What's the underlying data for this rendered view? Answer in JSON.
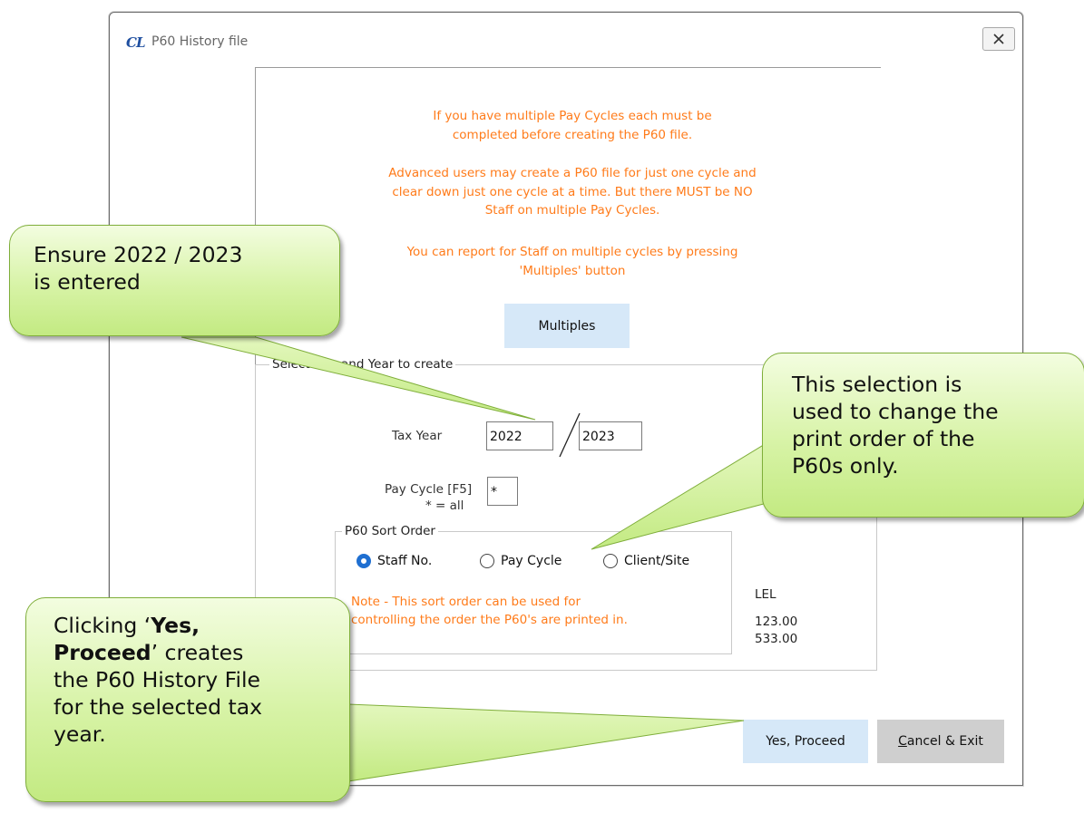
{
  "window": {
    "logo_text": "CL",
    "title": "P60 History file"
  },
  "info": {
    "para1_line1": "If you have multiple Pay Cycles each must be",
    "para1_line2": "completed before creating the P60 file.",
    "para2_line1": "Advanced users may create a P60 file for just one cycle and",
    "para2_line2": "clear down just one cycle at a time. But there MUST be NO",
    "para2_line3": "Staff on multiple Pay Cycles.",
    "para3_line1": "You can report for Staff on multiple cycles by pressing",
    "para3_line2": "'Multiples' button"
  },
  "buttons": {
    "multiples": "Multiples",
    "yes_proceed": "Yes, Proceed",
    "cancel_exit_underlined": "C",
    "cancel_exit_rest": "ancel & Exit"
  },
  "group": {
    "legend_visible": "Select",
    "legend_visible_tail": "and Year to create",
    "tax_year_label": "Tax Year",
    "tax_year_from": "2022",
    "tax_year_to": "2023",
    "pay_cycle_label": "Pay Cycle [F5]",
    "pay_cycle_hint": "* = all",
    "pay_cycle_value": "*"
  },
  "sort": {
    "legend": "P60 Sort Order",
    "options": [
      "Staff No.",
      "Pay Cycle",
      "Client/Site"
    ],
    "selected": "Staff No.",
    "note_line1": "Note - This sort order can be used for",
    "note_line2": "controlling the order the P60's are printed in."
  },
  "lel": {
    "label": "LEL",
    "value1": "123.00",
    "value2": "533.00"
  },
  "callouts": {
    "c1_line1": "Ensure 2022 / 2023",
    "c1_line2": "is entered",
    "c2_line1": "This selection is",
    "c2_line2": "used to change the",
    "c2_line3": "print order of the",
    "c2_line4": "P60s only.",
    "c3_prefix": "Clicking ‘",
    "c3_bold": "Yes,",
    "c3_bold2": "Proceed",
    "c3_suffix": "’ creates",
    "c3_line3": "the P60 History File",
    "c3_line4": "for the selected tax",
    "c3_line5": "year."
  },
  "colors": {
    "instruction_text": "#ff7b1a",
    "primary_button": "#d6e8f8",
    "radio_selected": "#1f6fd1",
    "callout_fill": "#d7f3a6"
  }
}
